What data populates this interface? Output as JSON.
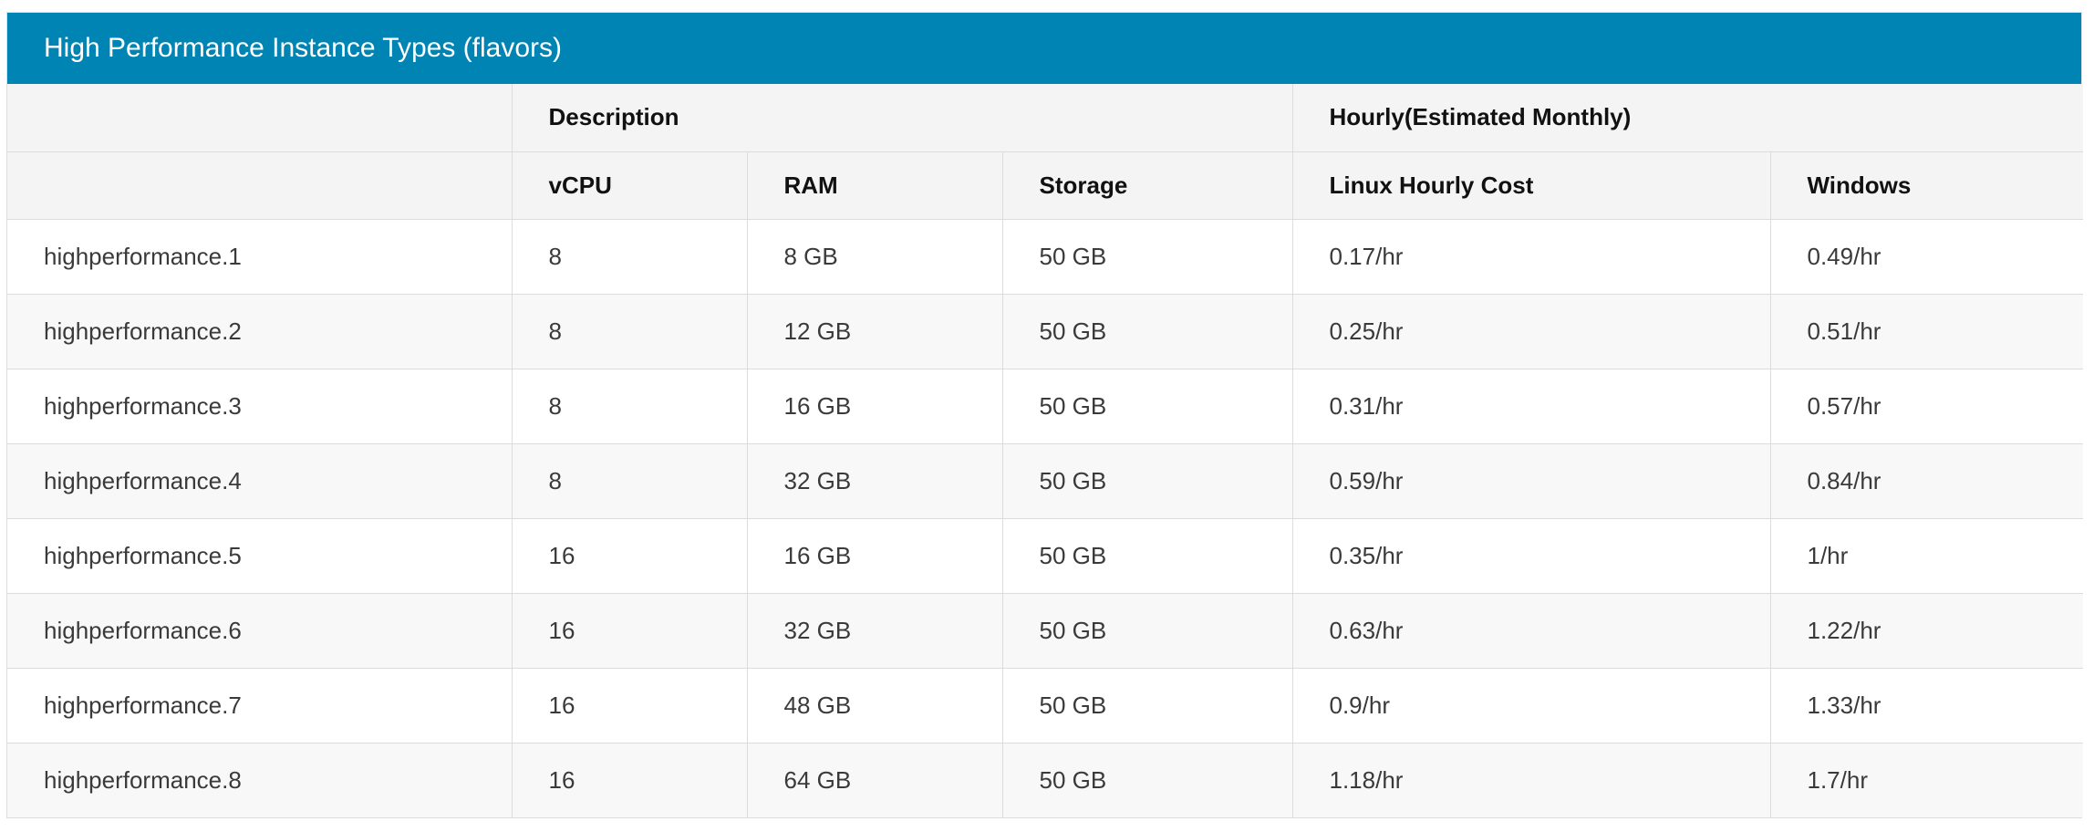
{
  "panel": {
    "title": "High Performance Instance Types (flavors)"
  },
  "table": {
    "group_headers": {
      "first": "",
      "description": "Description",
      "pricing": "Hourly(Estimated Monthly)"
    },
    "columns": [
      "",
      "vCPU",
      "RAM",
      "Storage",
      "Linux Hourly Cost",
      "Windows"
    ],
    "rows": [
      [
        "highperformance.1",
        "8",
        "8 GB",
        "50 GB",
        "0.17/hr",
        "0.49/hr"
      ],
      [
        "highperformance.2",
        "8",
        "12 GB",
        "50 GB",
        "0.25/hr",
        "0.51/hr"
      ],
      [
        "highperformance.3",
        "8",
        "16 GB",
        "50 GB",
        "0.31/hr",
        "0.57/hr"
      ],
      [
        "highperformance.4",
        "8",
        "32 GB",
        "50 GB",
        "0.59/hr",
        "0.84/hr"
      ],
      [
        "highperformance.5",
        "16",
        "16 GB",
        "50 GB",
        "0.35/hr",
        "1/hr"
      ],
      [
        "highperformance.6",
        "16",
        "32 GB",
        "50 GB",
        "0.63/hr",
        "1.22/hr"
      ],
      [
        "highperformance.7",
        "16",
        "48 GB",
        "50 GB",
        "0.9/hr",
        "1.33/hr"
      ],
      [
        "highperformance.8",
        "16",
        "64 GB",
        "50 GB",
        "1.18/hr",
        "1.7/hr"
      ]
    ]
  },
  "colors": {
    "header_bg": "#0084b4",
    "header_text": "#ffffff",
    "subheader_bg": "#f4f4f4",
    "row_alt_bg": "#f8f8f8",
    "border": "#dcdcdc"
  }
}
